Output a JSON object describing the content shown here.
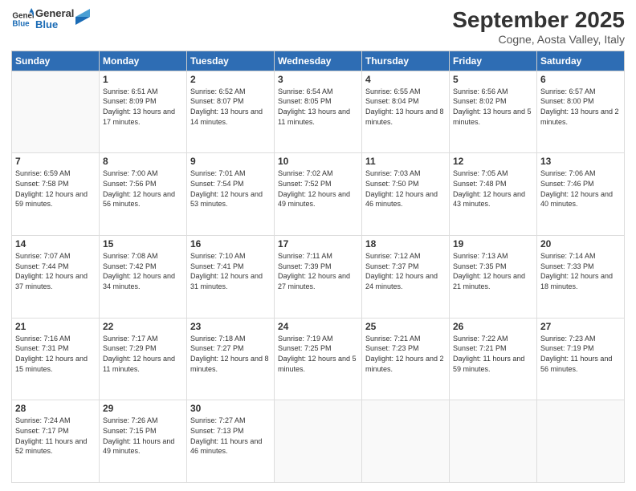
{
  "logo": {
    "line1": "General",
    "line2": "Blue"
  },
  "title": "September 2025",
  "subtitle": "Cogne, Aosta Valley, Italy",
  "weekdays": [
    "Sunday",
    "Monday",
    "Tuesday",
    "Wednesday",
    "Thursday",
    "Friday",
    "Saturday"
  ],
  "weeks": [
    [
      {
        "day": "",
        "info": ""
      },
      {
        "day": "1",
        "info": "Sunrise: 6:51 AM\nSunset: 8:09 PM\nDaylight: 13 hours\nand 17 minutes."
      },
      {
        "day": "2",
        "info": "Sunrise: 6:52 AM\nSunset: 8:07 PM\nDaylight: 13 hours\nand 14 minutes."
      },
      {
        "day": "3",
        "info": "Sunrise: 6:54 AM\nSunset: 8:05 PM\nDaylight: 13 hours\nand 11 minutes."
      },
      {
        "day": "4",
        "info": "Sunrise: 6:55 AM\nSunset: 8:04 PM\nDaylight: 13 hours\nand 8 minutes."
      },
      {
        "day": "5",
        "info": "Sunrise: 6:56 AM\nSunset: 8:02 PM\nDaylight: 13 hours\nand 5 minutes."
      },
      {
        "day": "6",
        "info": "Sunrise: 6:57 AM\nSunset: 8:00 PM\nDaylight: 13 hours\nand 2 minutes."
      }
    ],
    [
      {
        "day": "7",
        "info": "Sunrise: 6:59 AM\nSunset: 7:58 PM\nDaylight: 12 hours\nand 59 minutes."
      },
      {
        "day": "8",
        "info": "Sunrise: 7:00 AM\nSunset: 7:56 PM\nDaylight: 12 hours\nand 56 minutes."
      },
      {
        "day": "9",
        "info": "Sunrise: 7:01 AM\nSunset: 7:54 PM\nDaylight: 12 hours\nand 53 minutes."
      },
      {
        "day": "10",
        "info": "Sunrise: 7:02 AM\nSunset: 7:52 PM\nDaylight: 12 hours\nand 49 minutes."
      },
      {
        "day": "11",
        "info": "Sunrise: 7:03 AM\nSunset: 7:50 PM\nDaylight: 12 hours\nand 46 minutes."
      },
      {
        "day": "12",
        "info": "Sunrise: 7:05 AM\nSunset: 7:48 PM\nDaylight: 12 hours\nand 43 minutes."
      },
      {
        "day": "13",
        "info": "Sunrise: 7:06 AM\nSunset: 7:46 PM\nDaylight: 12 hours\nand 40 minutes."
      }
    ],
    [
      {
        "day": "14",
        "info": "Sunrise: 7:07 AM\nSunset: 7:44 PM\nDaylight: 12 hours\nand 37 minutes."
      },
      {
        "day": "15",
        "info": "Sunrise: 7:08 AM\nSunset: 7:42 PM\nDaylight: 12 hours\nand 34 minutes."
      },
      {
        "day": "16",
        "info": "Sunrise: 7:10 AM\nSunset: 7:41 PM\nDaylight: 12 hours\nand 31 minutes."
      },
      {
        "day": "17",
        "info": "Sunrise: 7:11 AM\nSunset: 7:39 PM\nDaylight: 12 hours\nand 27 minutes."
      },
      {
        "day": "18",
        "info": "Sunrise: 7:12 AM\nSunset: 7:37 PM\nDaylight: 12 hours\nand 24 minutes."
      },
      {
        "day": "19",
        "info": "Sunrise: 7:13 AM\nSunset: 7:35 PM\nDaylight: 12 hours\nand 21 minutes."
      },
      {
        "day": "20",
        "info": "Sunrise: 7:14 AM\nSunset: 7:33 PM\nDaylight: 12 hours\nand 18 minutes."
      }
    ],
    [
      {
        "day": "21",
        "info": "Sunrise: 7:16 AM\nSunset: 7:31 PM\nDaylight: 12 hours\nand 15 minutes."
      },
      {
        "day": "22",
        "info": "Sunrise: 7:17 AM\nSunset: 7:29 PM\nDaylight: 12 hours\nand 11 minutes."
      },
      {
        "day": "23",
        "info": "Sunrise: 7:18 AM\nSunset: 7:27 PM\nDaylight: 12 hours\nand 8 minutes."
      },
      {
        "day": "24",
        "info": "Sunrise: 7:19 AM\nSunset: 7:25 PM\nDaylight: 12 hours\nand 5 minutes."
      },
      {
        "day": "25",
        "info": "Sunrise: 7:21 AM\nSunset: 7:23 PM\nDaylight: 12 hours\nand 2 minutes."
      },
      {
        "day": "26",
        "info": "Sunrise: 7:22 AM\nSunset: 7:21 PM\nDaylight: 11 hours\nand 59 minutes."
      },
      {
        "day": "27",
        "info": "Sunrise: 7:23 AM\nSunset: 7:19 PM\nDaylight: 11 hours\nand 56 minutes."
      }
    ],
    [
      {
        "day": "28",
        "info": "Sunrise: 7:24 AM\nSunset: 7:17 PM\nDaylight: 11 hours\nand 52 minutes."
      },
      {
        "day": "29",
        "info": "Sunrise: 7:26 AM\nSunset: 7:15 PM\nDaylight: 11 hours\nand 49 minutes."
      },
      {
        "day": "30",
        "info": "Sunrise: 7:27 AM\nSunset: 7:13 PM\nDaylight: 11 hours\nand 46 minutes."
      },
      {
        "day": "",
        "info": ""
      },
      {
        "day": "",
        "info": ""
      },
      {
        "day": "",
        "info": ""
      },
      {
        "day": "",
        "info": ""
      }
    ]
  ]
}
